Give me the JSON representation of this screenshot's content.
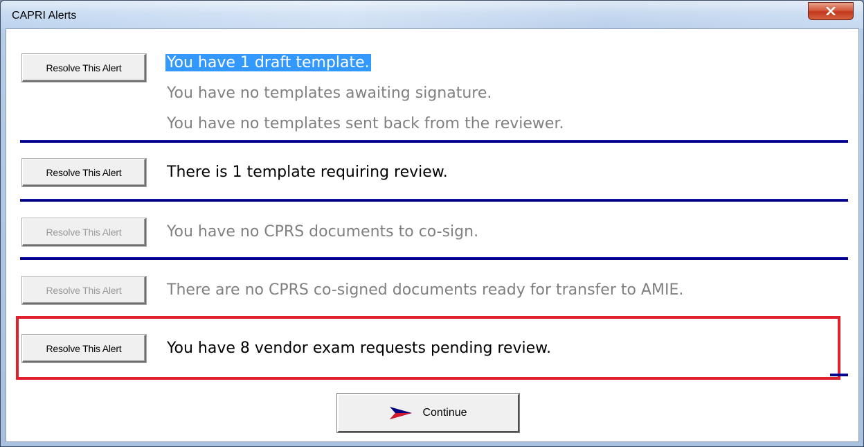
{
  "window": {
    "title": "CAPRI Alerts"
  },
  "alerts": [
    {
      "button_label": "Resolve This Alert",
      "lines": [
        "You have 1 draft template.",
        "You have no templates awaiting signature.",
        "You have no templates sent back from the reviewer."
      ]
    },
    {
      "button_label": "Resolve This Alert",
      "lines": [
        "There is 1 template requiring review."
      ]
    },
    {
      "button_label": "Resolve This Alert",
      "lines": [
        "You have no CPRS documents to co-sign."
      ]
    },
    {
      "button_label": "Resolve This Alert",
      "lines": [
        "There are no CPRS co-signed documents ready for transfer to AMIE."
      ]
    },
    {
      "button_label": "Resolve This Alert",
      "lines": [
        "You have 8 vendor exam requests pending review."
      ]
    }
  ],
  "footer": {
    "continue_label": "Continue"
  },
  "colors": {
    "separator": "#00008b",
    "highlight_box": "#e0202a",
    "selection": "#3399ff",
    "disabled_text": "#808080"
  }
}
